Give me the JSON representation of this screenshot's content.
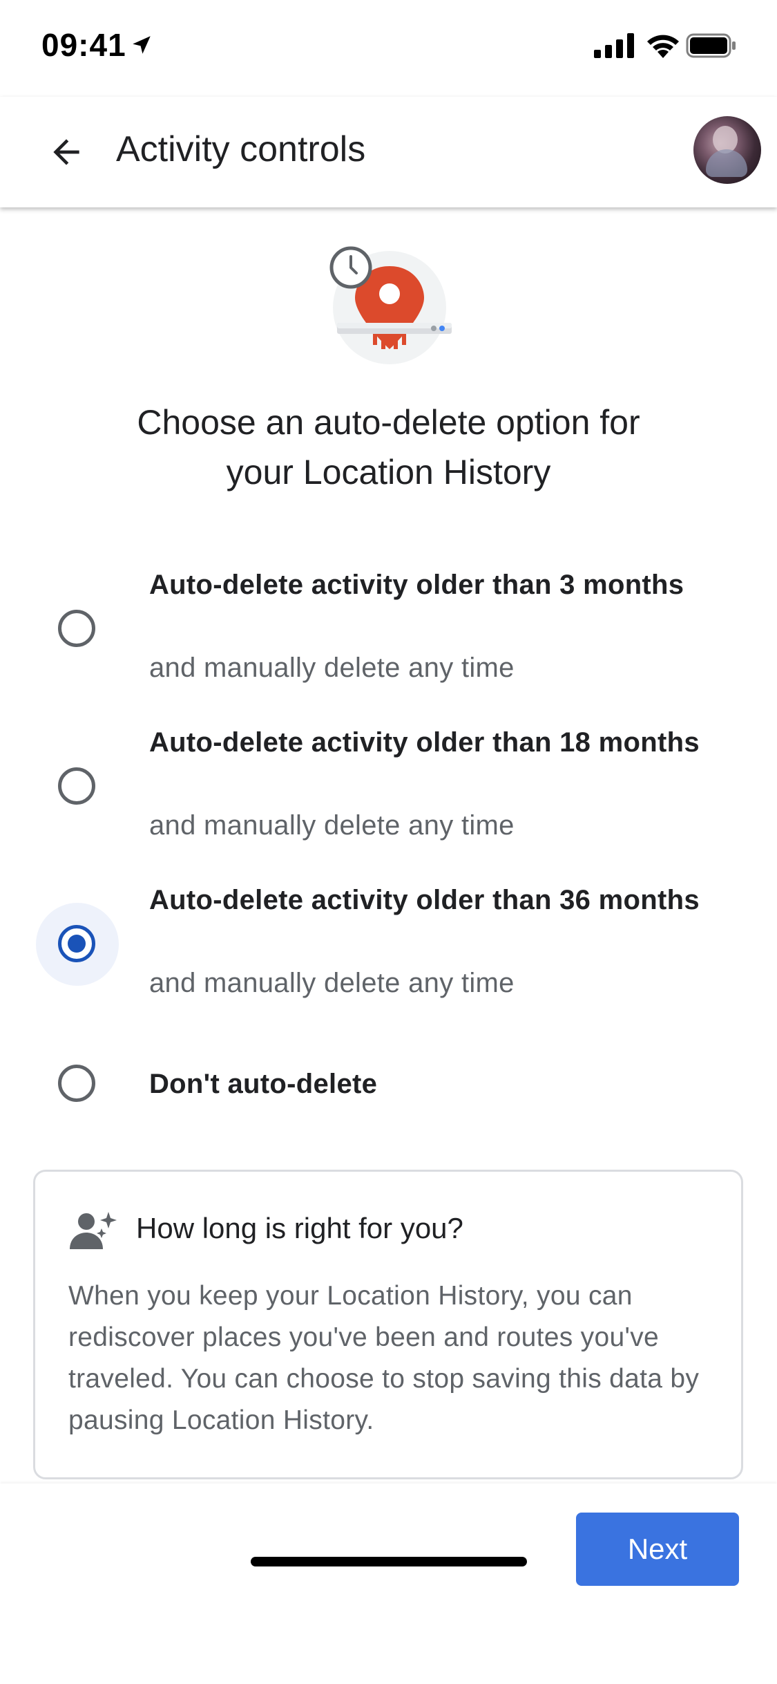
{
  "status_bar": {
    "time": "09:41"
  },
  "app_bar": {
    "title": "Activity controls"
  },
  "headline": "Choose an auto-delete option for your Location History",
  "options": [
    {
      "title": "Auto-delete activity older than 3 months",
      "subtitle": "and manually delete any time",
      "selected": false
    },
    {
      "title": "Auto-delete activity older than 18 months",
      "subtitle": "and manually delete any time",
      "selected": false
    },
    {
      "title": "Auto-delete activity older than 36 months",
      "subtitle": "and manually delete any time",
      "selected": true
    },
    {
      "title": "Don't auto-delete",
      "subtitle": "",
      "selected": false
    }
  ],
  "info_card": {
    "icon": "person-sparkle-icon",
    "title": "How long is right for you?",
    "body": "When you keep your Location History, you can rediscover places you've been and routes you've traveled. You can choose to stop saving this data by pausing Location History."
  },
  "footer": {
    "next_label": "Next"
  },
  "colors": {
    "primary": "#1a53b8",
    "button": "#3a73e0",
    "pin": "#dc4a2c"
  }
}
